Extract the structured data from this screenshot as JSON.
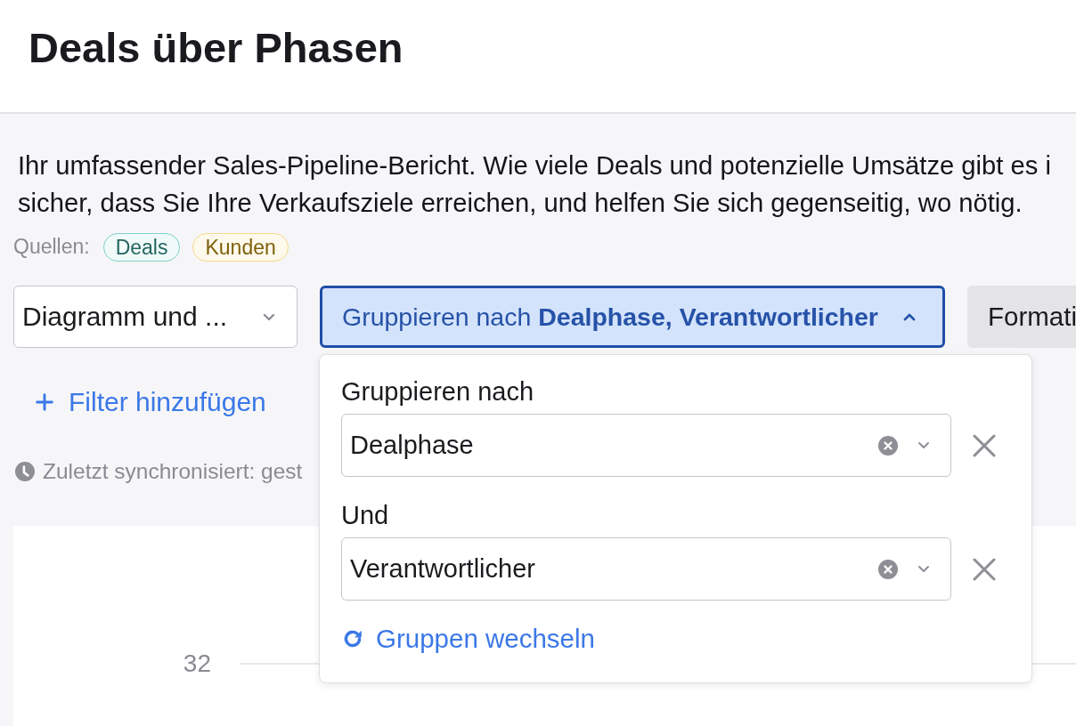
{
  "page": {
    "title": "Deals über Phasen"
  },
  "report": {
    "description": [
      "Ihr umfassender Sales-Pipeline-Bericht. Wie viele Deals und potenzielle Umsätze gibt es i",
      "sicher, dass Sie Ihre Verkaufsziele erreichen, und helfen Sie sich gegenseitig, wo nötig."
    ],
    "sources_label": "Quellen:",
    "sources": [
      {
        "label": "Deals",
        "color": "#7fd1cc"
      },
      {
        "label": "Kunden",
        "color": "#f5d98c"
      }
    ]
  },
  "toolbar": {
    "view_select": {
      "value": "Diagramm und ..."
    },
    "group_button": {
      "label": "Gruppieren nach **Dealphase, Verantwortlicher**",
      "expanded": true
    },
    "format_button": {
      "label": "Formati"
    }
  },
  "group_menu": {
    "groups": [
      {
        "label": "Gruppieren nach",
        "value": "Dealphase"
      },
      {
        "label": "Und",
        "value": "Verantwortlicher"
      }
    ],
    "swap_link": "Gruppen wechseln"
  },
  "filter_link": "Filter hinzufügen",
  "sync_status": "Zuletzt synchronisiert: gest",
  "chart": {
    "y_axis_labels": [
      "32"
    ]
  }
}
